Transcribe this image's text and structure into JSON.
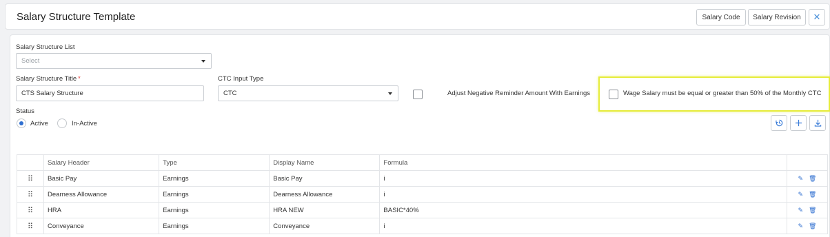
{
  "header": {
    "title": "Salary Structure Template",
    "salary_code_label": "Salary Code",
    "salary_revision_label": "Salary Revision",
    "close_glyph": "✕"
  },
  "form": {
    "list_label": "Salary Structure List",
    "list_placeholder": "Select",
    "title_label": "Salary Structure Title",
    "title_required": "*",
    "title_value": "CTS Salary Structure",
    "ctc_label": "CTC Input Type",
    "ctc_value": "CTC",
    "adjust_label": "Adjust Negative Reminder Amount With Earnings",
    "wage_label": "Wage Salary must be equal or greater than 50% of the Monthly CTC",
    "status_label": "Status",
    "status_active": "Active",
    "status_inactive": "In-Active",
    "status_selected": "Active"
  },
  "toolbar": {
    "icons": [
      "history-icon",
      "add-icon",
      "download-icon"
    ]
  },
  "table": {
    "columns": [
      "Salary Header",
      "Type",
      "Display Name",
      "Formula"
    ],
    "rows": [
      {
        "header": "Basic Pay",
        "type": "Earnings",
        "display": "Basic Pay",
        "formula": "i"
      },
      {
        "header": "Dearness Allowance",
        "type": "Earnings",
        "display": "Dearness Allowance",
        "formula": "i"
      },
      {
        "header": "HRA",
        "type": "Earnings",
        "display": "HRA NEW",
        "formula": "BASIC*40%"
      },
      {
        "header": "Conveyance",
        "type": "Earnings",
        "display": "Conveyance",
        "formula": "i"
      }
    ]
  },
  "colors": {
    "accent": "#2f6fd0",
    "highlight": "#e6ec3a",
    "required": "#e53935"
  }
}
